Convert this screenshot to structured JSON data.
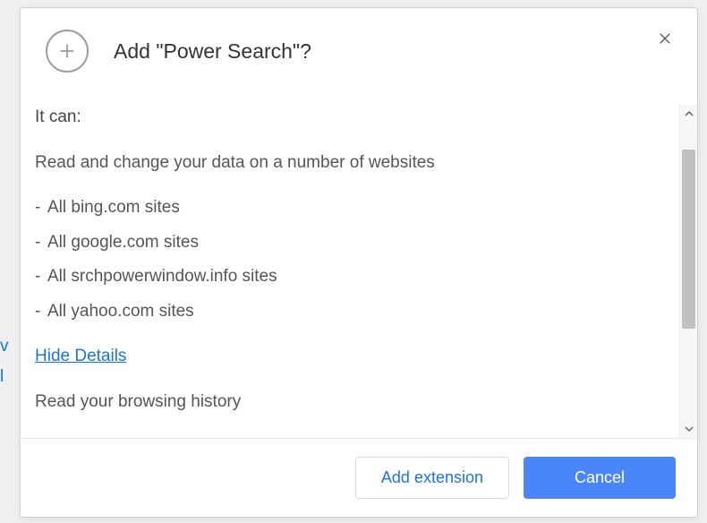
{
  "dialog": {
    "title": "Add \"Power Search\"?",
    "intro": "It can:",
    "permissions": {
      "readChange": "Read and change your data on a number of websites",
      "sites": [
        "All bing.com sites",
        "All google.com sites",
        "All srchpowerwindow.info sites",
        "All yahoo.com sites"
      ],
      "history": "Read your browsing history"
    },
    "hideDetails": "Hide Details",
    "buttons": {
      "add": "Add extension",
      "cancel": "Cancel"
    }
  },
  "leftEdge": {
    "line1": "v",
    "line2": "l"
  }
}
